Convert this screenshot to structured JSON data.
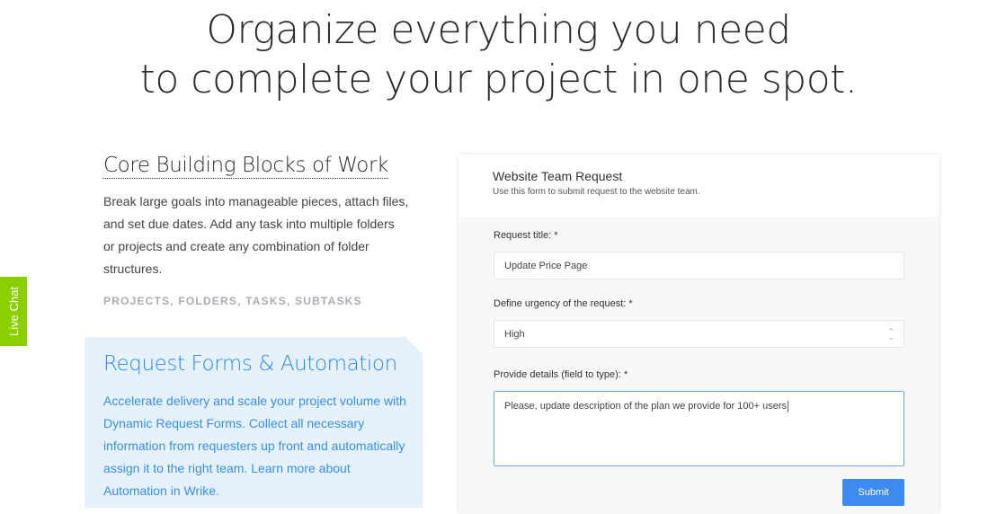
{
  "hero": {
    "line1": "Organize everything you need",
    "line2": "to complete your project in one spot."
  },
  "core": {
    "title": "Core Building Blocks of Work",
    "body": "Break large goals into manageable pieces, attach files, and set due dates. Add any task into multiple folders or projects and create any combination of folder structures.",
    "tags": "PROJECTS, FOLDERS, TASKS, SUBTASKS"
  },
  "live_chat": "Live Chat",
  "forms": {
    "title": "Request Forms & Automation",
    "body": "Accelerate delivery and scale your project volume with Dynamic Request Forms. Collect all necessary information from requesters up front and automatically assign it to the right team. Learn more about Automation in Wrike."
  },
  "form": {
    "title": "Website Team Request",
    "subtitle": "Use this form to submit request to the website team.",
    "fields": [
      {
        "label": "Request title: *",
        "value": "Update Price Page"
      },
      {
        "label": "Define urgency of the request: *",
        "value": "High"
      },
      {
        "label": "Provide details (field to type): *",
        "value": "Please, update description of the plan we provide for 100+ users"
      }
    ],
    "submit": "Submit"
  },
  "colors": {
    "accent": "#3d8bf2",
    "live_chat": "#8ccf00",
    "panel": "#e5f1fd"
  }
}
